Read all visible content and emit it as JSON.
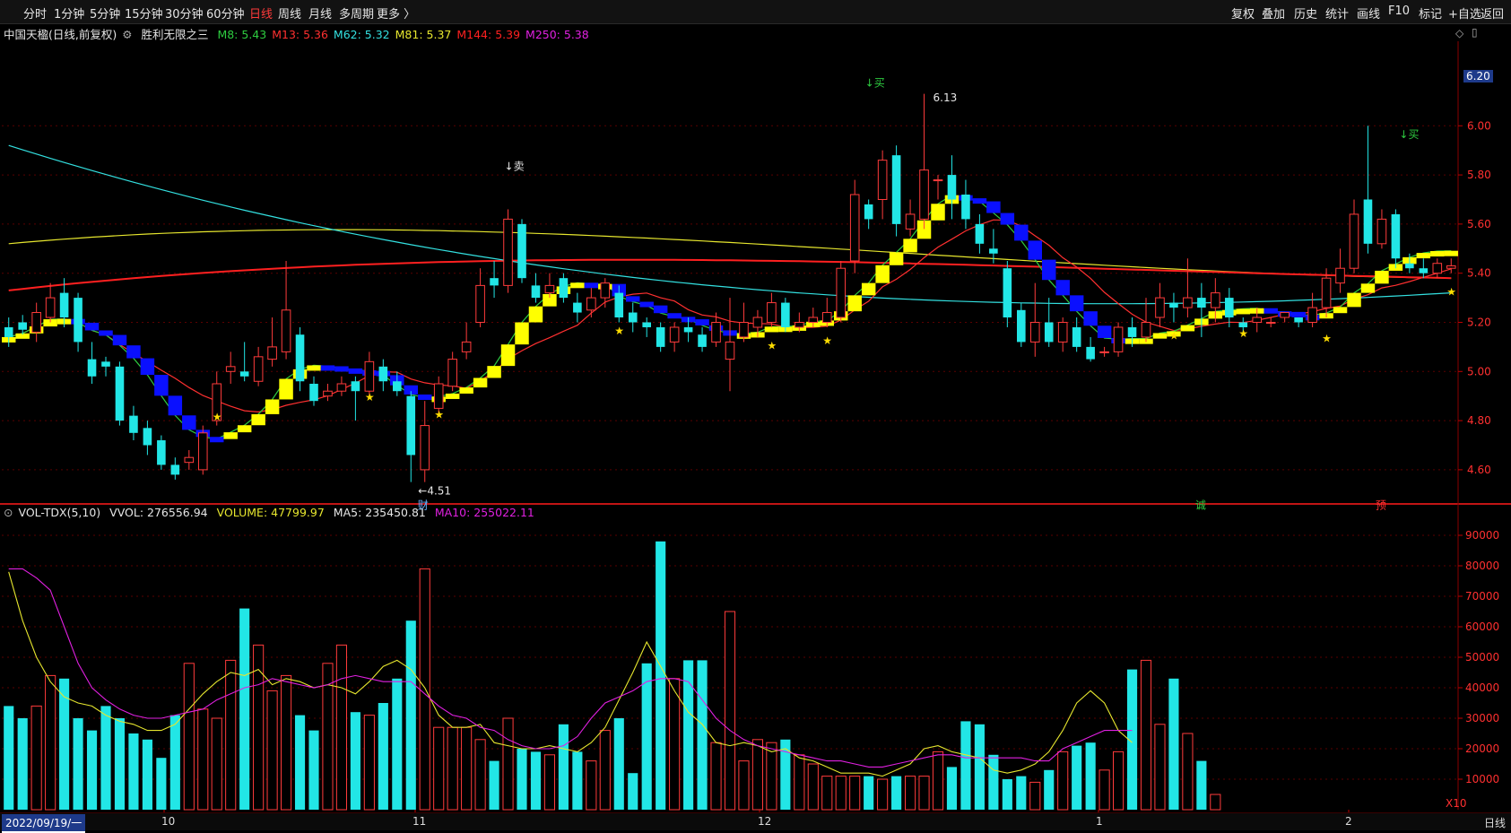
{
  "toolbar": {
    "periods": [
      "分时",
      "1分钟",
      "5分钟",
      "15分钟",
      "30分钟",
      "60分钟",
      "日线",
      "周线",
      "月线",
      "多周期",
      "更多 〉"
    ],
    "active_period": "日线",
    "right_tools": [
      "复权",
      "叠加",
      "历史",
      "统计",
      "画线",
      "F10",
      "标记",
      "+自选",
      "返回"
    ]
  },
  "main_header": {
    "stock": "中国天楹(日线,前复权)",
    "indicator_name": "胜利无限之三",
    "ma": [
      {
        "label": "M8: 5.43",
        "color": "#2ecc40"
      },
      {
        "label": "M13: 5.36",
        "color": "#ff3030"
      },
      {
        "label": "M62: 5.32",
        "color": "#33e0e0"
      },
      {
        "label": "M81: 5.37",
        "color": "#e6e62e"
      },
      {
        "label": "M144: 5.39",
        "color": "#ff2020"
      },
      {
        "label": "M250: 5.38",
        "color": "#e020e0"
      }
    ]
  },
  "vol_header": {
    "name": "VOL-TDX(5,10)",
    "vvol": "VVOL: 276556.94",
    "volume": {
      "label": "VOLUME: 47799.97",
      "color": "#e6e62e"
    },
    "ma5": {
      "label": "MA5: 235450.81",
      "color": "#e6e6e6"
    },
    "ma10": {
      "label": "MA10: 255022.11",
      "color": "#e020e0"
    }
  },
  "price_axis": [
    "6.00",
    "5.80",
    "5.60",
    "5.40",
    "5.20",
    "5.00",
    "4.80",
    "4.60"
  ],
  "price_badge": "6.20",
  "vol_axis": [
    "90000",
    "80000",
    "70000",
    "60000",
    "50000",
    "40000",
    "30000",
    "20000",
    "10000"
  ],
  "vol_unit": "X10",
  "annotations": {
    "high": "6.13",
    "low": "←4.51",
    "sell": "↓卖",
    "buy": "↓买",
    "events": [
      "财",
      "诚",
      "预"
    ]
  },
  "bottom": {
    "date": "2022/09/19/一",
    "months": [
      "10",
      "11",
      "12",
      "1",
      "2"
    ],
    "period": "日线"
  },
  "colors": {
    "up": "#ff3b3b",
    "down": "#22e6e6",
    "grid": "#5a0000"
  },
  "chart_data": {
    "type": "candlestick",
    "candles": [
      [
        5.18,
        5.14,
        5.22,
        5.1
      ],
      [
        5.2,
        5.17,
        5.23,
        5.15
      ],
      [
        5.16,
        5.24,
        5.28,
        5.12
      ],
      [
        5.22,
        5.3,
        5.36,
        5.2
      ],
      [
        5.32,
        5.22,
        5.38,
        5.18
      ],
      [
        5.3,
        5.12,
        5.32,
        5.08
      ],
      [
        5.05,
        4.98,
        5.12,
        4.95
      ],
      [
        5.04,
        5.02,
        5.06,
        4.98
      ],
      [
        5.02,
        4.8,
        5.04,
        4.78
      ],
      [
        4.82,
        4.75,
        4.86,
        4.72
      ],
      [
        4.77,
        4.7,
        4.8,
        4.66
      ],
      [
        4.72,
        4.62,
        4.74,
        4.6
      ],
      [
        4.62,
        4.58,
        4.65,
        4.56
      ],
      [
        4.63,
        4.65,
        4.68,
        4.6
      ],
      [
        4.6,
        4.75,
        4.78,
        4.58
      ],
      [
        4.8,
        4.95,
        5.0,
        4.78
      ],
      [
        5.0,
        5.02,
        5.08,
        4.95
      ],
      [
        5.0,
        4.98,
        5.12,
        4.96
      ],
      [
        4.96,
        5.06,
        5.1,
        4.94
      ],
      [
        5.05,
        5.1,
        5.22,
        5.02
      ],
      [
        5.08,
        5.25,
        5.45,
        5.05
      ],
      [
        5.15,
        4.96,
        5.18,
        4.92
      ],
      [
        4.95,
        4.88,
        4.98,
        4.86
      ],
      [
        4.9,
        4.92,
        4.95,
        4.88
      ],
      [
        4.92,
        4.95,
        4.98,
        4.9
      ],
      [
        4.96,
        4.92,
        4.98,
        4.8
      ],
      [
        4.92,
        5.04,
        5.08,
        4.9
      ],
      [
        5.02,
        4.96,
        5.05,
        4.92
      ],
      [
        4.96,
        4.92,
        5.0,
        4.9
      ],
      [
        4.9,
        4.66,
        4.92,
        4.55
      ],
      [
        4.6,
        4.78,
        4.88,
        4.55
      ],
      [
        4.85,
        4.95,
        4.98,
        4.82
      ],
      [
        4.94,
        5.05,
        5.08,
        4.92
      ],
      [
        5.08,
        5.12,
        5.2,
        5.05
      ],
      [
        5.2,
        5.35,
        5.42,
        5.18
      ],
      [
        5.38,
        5.35,
        5.45,
        5.3
      ],
      [
        5.35,
        5.62,
        5.66,
        5.32
      ],
      [
        5.6,
        5.38,
        5.62,
        5.36
      ],
      [
        5.35,
        5.3,
        5.4,
        5.28
      ],
      [
        5.32,
        5.35,
        5.4,
        5.3
      ],
      [
        5.38,
        5.3,
        5.4,
        5.28
      ],
      [
        5.28,
        5.24,
        5.32,
        5.2
      ],
      [
        5.25,
        5.3,
        5.34,
        5.22
      ],
      [
        5.3,
        5.36,
        5.38,
        5.26
      ],
      [
        5.32,
        5.22,
        5.35,
        5.2
      ],
      [
        5.24,
        5.2,
        5.28,
        5.16
      ],
      [
        5.2,
        5.18,
        5.22,
        5.14
      ],
      [
        5.18,
        5.1,
        5.2,
        5.08
      ],
      [
        5.12,
        5.18,
        5.2,
        5.08
      ],
      [
        5.18,
        5.16,
        5.22,
        5.12
      ],
      [
        5.15,
        5.1,
        5.18,
        5.08
      ],
      [
        5.12,
        5.2,
        5.24,
        5.1
      ],
      [
        5.05,
        5.12,
        5.3,
        4.92
      ],
      [
        5.14,
        5.2,
        5.28,
        5.12
      ],
      [
        5.18,
        5.22,
        5.25,
        5.14
      ],
      [
        5.2,
        5.28,
        5.32,
        5.18
      ],
      [
        5.28,
        5.18,
        5.3,
        5.16
      ],
      [
        5.18,
        5.2,
        5.24,
        5.16
      ],
      [
        5.2,
        5.22,
        5.26,
        5.18
      ],
      [
        5.2,
        5.24,
        5.3,
        5.18
      ],
      [
        5.22,
        5.42,
        5.45,
        5.2
      ],
      [
        5.45,
        5.72,
        5.78,
        5.4
      ],
      [
        5.68,
        5.62,
        5.7,
        5.58
      ],
      [
        5.7,
        5.86,
        5.9,
        5.62
      ],
      [
        5.88,
        5.6,
        5.92,
        5.55
      ],
      [
        5.58,
        5.64,
        5.7,
        5.55
      ],
      [
        5.62,
        5.82,
        6.13,
        5.58
      ],
      [
        5.78,
        5.78,
        5.8,
        5.7
      ],
      [
        5.8,
        5.7,
        5.88,
        5.62
      ],
      [
        5.72,
        5.62,
        5.78,
        5.58
      ],
      [
        5.6,
        5.52,
        5.64,
        5.48
      ],
      [
        5.5,
        5.48,
        5.58,
        5.44
      ],
      [
        5.42,
        5.22,
        5.45,
        5.18
      ],
      [
        5.25,
        5.12,
        5.28,
        5.1
      ],
      [
        5.12,
        5.2,
        5.36,
        5.06
      ],
      [
        5.2,
        5.12,
        5.3,
        5.1
      ],
      [
        5.12,
        5.2,
        5.22,
        5.08
      ],
      [
        5.18,
        5.1,
        5.22,
        5.08
      ],
      [
        5.1,
        5.05,
        5.14,
        5.04
      ],
      [
        5.08,
        5.08,
        5.1,
        5.06
      ],
      [
        5.08,
        5.18,
        5.2,
        5.06
      ],
      [
        5.18,
        5.14,
        5.22,
        5.1
      ],
      [
        5.14,
        5.2,
        5.3,
        5.12
      ],
      [
        5.22,
        5.3,
        5.36,
        5.18
      ],
      [
        5.28,
        5.26,
        5.32,
        5.2
      ],
      [
        5.26,
        5.3,
        5.46,
        5.22
      ],
      [
        5.3,
        5.26,
        5.36,
        5.14
      ],
      [
        5.26,
        5.32,
        5.38,
        5.2
      ],
      [
        5.3,
        5.22,
        5.34,
        5.18
      ],
      [
        5.2,
        5.18,
        5.22,
        5.16
      ],
      [
        5.2,
        5.22,
        5.26,
        5.16
      ],
      [
        5.2,
        5.2,
        5.22,
        5.18
      ],
      [
        5.22,
        5.24,
        5.24,
        5.2
      ],
      [
        5.22,
        5.2,
        5.22,
        5.18
      ],
      [
        5.2,
        5.26,
        5.32,
        5.18
      ],
      [
        5.26,
        5.38,
        5.42,
        5.22
      ],
      [
        5.36,
        5.42,
        5.5,
        5.32
      ],
      [
        5.42,
        5.64,
        5.7,
        5.4
      ],
      [
        5.7,
        5.52,
        6.0,
        5.48
      ],
      [
        5.52,
        5.62,
        5.66,
        5.5
      ],
      [
        5.64,
        5.46,
        5.66,
        5.42
      ],
      [
        5.44,
        5.42,
        5.48,
        5.4
      ],
      [
        5.42,
        5.4,
        5.46,
        5.38
      ],
      [
        5.4,
        5.44,
        5.46,
        5.38
      ],
      [
        5.42,
        5.43,
        5.46,
        5.4
      ]
    ],
    "volumes": [
      34,
      30,
      34,
      44,
      43,
      30,
      26,
      34,
      30,
      25,
      23,
      17,
      31,
      48,
      33,
      30,
      49,
      66,
      54,
      39,
      44,
      31,
      26,
      48,
      54,
      32,
      31,
      35,
      43,
      62,
      79,
      27,
      27,
      27,
      23,
      16,
      30,
      20,
      19,
      18,
      28,
      19,
      16,
      26,
      30,
      12,
      48,
      88,
      43,
      49,
      49,
      22,
      65,
      16,
      23,
      22,
      23,
      18,
      15,
      11,
      11,
      11,
      11,
      10,
      11,
      11,
      11,
      19,
      14,
      29,
      28,
      18,
      10,
      11,
      9,
      13,
      19,
      21,
      22,
      13,
      19,
      46,
      49,
      28,
      43,
      25,
      16,
      5
    ],
    "vol_ma5": [
      78,
      62,
      50,
      42,
      37,
      35,
      34,
      31,
      29,
      28,
      26,
      26,
      28,
      33,
      38,
      42,
      45,
      44,
      46,
      41,
      43,
      42,
      40,
      41,
      40,
      38,
      42,
      47,
      49,
      46,
      40,
      31,
      27,
      27,
      28,
      22,
      21,
      20,
      20,
      21,
      20,
      19,
      22,
      27,
      36,
      45,
      55,
      47,
      39,
      32,
      28,
      22,
      21,
      22,
      21,
      19,
      20,
      17,
      16,
      14,
      12,
      12,
      12,
      11,
      13,
      15,
      20,
      21,
      19,
      18,
      17,
      13,
      12,
      13,
      15,
      19,
      26,
      35,
      39,
      35,
      26,
      22
    ],
    "vol_ma10": [
      79,
      79,
      76,
      72,
      60,
      48,
      40,
      36,
      33,
      31,
      30,
      30,
      31,
      32,
      33,
      36,
      38,
      40,
      41,
      43,
      42,
      41,
      40,
      41,
      43,
      44,
      43,
      42,
      42,
      42,
      38,
      34,
      31,
      30,
      27,
      26,
      23,
      21,
      20,
      20,
      21,
      24,
      30,
      35,
      37,
      39,
      42,
      43,
      43,
      42,
      36,
      30,
      26,
      23,
      21,
      20,
      19,
      18,
      17,
      16,
      16,
      15,
      14,
      14,
      15,
      16,
      17,
      18,
      18,
      17,
      17,
      17,
      17,
      17,
      16,
      16,
      20,
      22,
      24,
      26,
      26,
      26
    ],
    "ylim": [
      4.45,
      6.22
    ],
    "vol_ylim": [
      0,
      95000
    ]
  }
}
